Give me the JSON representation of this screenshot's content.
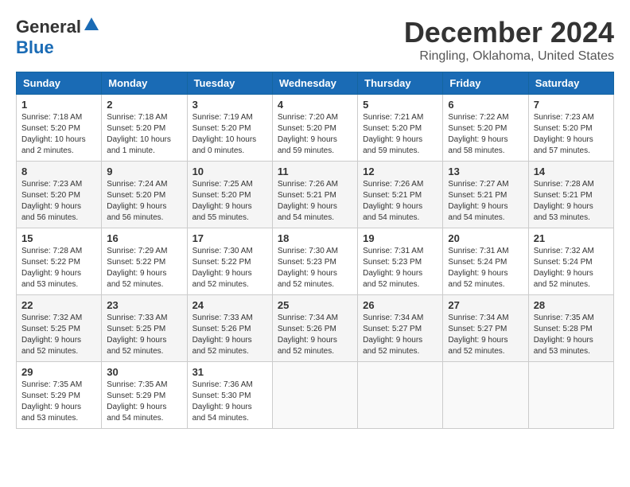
{
  "header": {
    "logo_general": "General",
    "logo_blue": "Blue",
    "month": "December 2024",
    "location": "Ringling, Oklahoma, United States"
  },
  "days_of_week": [
    "Sunday",
    "Monday",
    "Tuesday",
    "Wednesday",
    "Thursday",
    "Friday",
    "Saturday"
  ],
  "weeks": [
    [
      {
        "day": "1",
        "info": "Sunrise: 7:18 AM\nSunset: 5:20 PM\nDaylight: 10 hours\nand 2 minutes."
      },
      {
        "day": "2",
        "info": "Sunrise: 7:18 AM\nSunset: 5:20 PM\nDaylight: 10 hours\nand 1 minute."
      },
      {
        "day": "3",
        "info": "Sunrise: 7:19 AM\nSunset: 5:20 PM\nDaylight: 10 hours\nand 0 minutes."
      },
      {
        "day": "4",
        "info": "Sunrise: 7:20 AM\nSunset: 5:20 PM\nDaylight: 9 hours\nand 59 minutes."
      },
      {
        "day": "5",
        "info": "Sunrise: 7:21 AM\nSunset: 5:20 PM\nDaylight: 9 hours\nand 59 minutes."
      },
      {
        "day": "6",
        "info": "Sunrise: 7:22 AM\nSunset: 5:20 PM\nDaylight: 9 hours\nand 58 minutes."
      },
      {
        "day": "7",
        "info": "Sunrise: 7:23 AM\nSunset: 5:20 PM\nDaylight: 9 hours\nand 57 minutes."
      }
    ],
    [
      {
        "day": "8",
        "info": "Sunrise: 7:23 AM\nSunset: 5:20 PM\nDaylight: 9 hours\nand 56 minutes."
      },
      {
        "day": "9",
        "info": "Sunrise: 7:24 AM\nSunset: 5:20 PM\nDaylight: 9 hours\nand 56 minutes."
      },
      {
        "day": "10",
        "info": "Sunrise: 7:25 AM\nSunset: 5:20 PM\nDaylight: 9 hours\nand 55 minutes."
      },
      {
        "day": "11",
        "info": "Sunrise: 7:26 AM\nSunset: 5:21 PM\nDaylight: 9 hours\nand 54 minutes."
      },
      {
        "day": "12",
        "info": "Sunrise: 7:26 AM\nSunset: 5:21 PM\nDaylight: 9 hours\nand 54 minutes."
      },
      {
        "day": "13",
        "info": "Sunrise: 7:27 AM\nSunset: 5:21 PM\nDaylight: 9 hours\nand 54 minutes."
      },
      {
        "day": "14",
        "info": "Sunrise: 7:28 AM\nSunset: 5:21 PM\nDaylight: 9 hours\nand 53 minutes."
      }
    ],
    [
      {
        "day": "15",
        "info": "Sunrise: 7:28 AM\nSunset: 5:22 PM\nDaylight: 9 hours\nand 53 minutes."
      },
      {
        "day": "16",
        "info": "Sunrise: 7:29 AM\nSunset: 5:22 PM\nDaylight: 9 hours\nand 52 minutes."
      },
      {
        "day": "17",
        "info": "Sunrise: 7:30 AM\nSunset: 5:22 PM\nDaylight: 9 hours\nand 52 minutes."
      },
      {
        "day": "18",
        "info": "Sunrise: 7:30 AM\nSunset: 5:23 PM\nDaylight: 9 hours\nand 52 minutes."
      },
      {
        "day": "19",
        "info": "Sunrise: 7:31 AM\nSunset: 5:23 PM\nDaylight: 9 hours\nand 52 minutes."
      },
      {
        "day": "20",
        "info": "Sunrise: 7:31 AM\nSunset: 5:24 PM\nDaylight: 9 hours\nand 52 minutes."
      },
      {
        "day": "21",
        "info": "Sunrise: 7:32 AM\nSunset: 5:24 PM\nDaylight: 9 hours\nand 52 minutes."
      }
    ],
    [
      {
        "day": "22",
        "info": "Sunrise: 7:32 AM\nSunset: 5:25 PM\nDaylight: 9 hours\nand 52 minutes."
      },
      {
        "day": "23",
        "info": "Sunrise: 7:33 AM\nSunset: 5:25 PM\nDaylight: 9 hours\nand 52 minutes."
      },
      {
        "day": "24",
        "info": "Sunrise: 7:33 AM\nSunset: 5:26 PM\nDaylight: 9 hours\nand 52 minutes."
      },
      {
        "day": "25",
        "info": "Sunrise: 7:34 AM\nSunset: 5:26 PM\nDaylight: 9 hours\nand 52 minutes."
      },
      {
        "day": "26",
        "info": "Sunrise: 7:34 AM\nSunset: 5:27 PM\nDaylight: 9 hours\nand 52 minutes."
      },
      {
        "day": "27",
        "info": "Sunrise: 7:34 AM\nSunset: 5:27 PM\nDaylight: 9 hours\nand 52 minutes."
      },
      {
        "day": "28",
        "info": "Sunrise: 7:35 AM\nSunset: 5:28 PM\nDaylight: 9 hours\nand 53 minutes."
      }
    ],
    [
      {
        "day": "29",
        "info": "Sunrise: 7:35 AM\nSunset: 5:29 PM\nDaylight: 9 hours\nand 53 minutes."
      },
      {
        "day": "30",
        "info": "Sunrise: 7:35 AM\nSunset: 5:29 PM\nDaylight: 9 hours\nand 54 minutes."
      },
      {
        "day": "31",
        "info": "Sunrise: 7:36 AM\nSunset: 5:30 PM\nDaylight: 9 hours\nand 54 minutes."
      },
      {
        "day": "",
        "info": ""
      },
      {
        "day": "",
        "info": ""
      },
      {
        "day": "",
        "info": ""
      },
      {
        "day": "",
        "info": ""
      }
    ]
  ]
}
